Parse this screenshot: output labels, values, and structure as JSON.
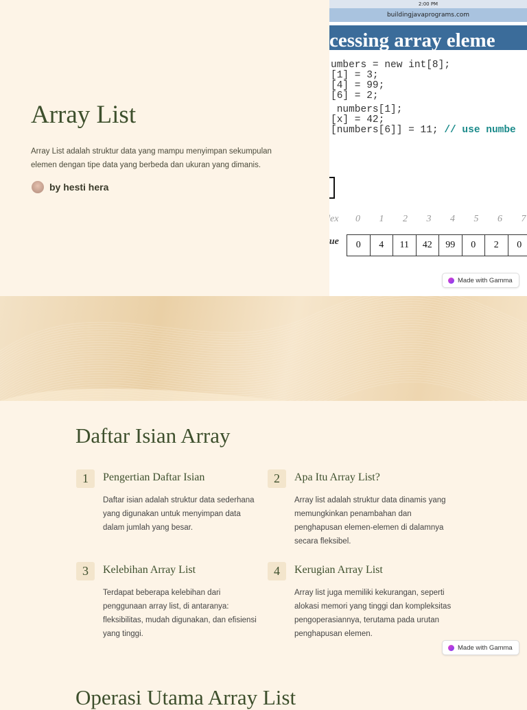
{
  "hero": {
    "title": "Array List",
    "description": "Array List adalah struktur data yang mampu menyimpan sekumpulan elemen dengan tipe data yang berbeda dan ukuran yang dimanis.",
    "author": "by hesti hera"
  },
  "screenshot": {
    "status_time": "2:00 PM",
    "url": "buildingjavaprograms.com",
    "slide_title": "cessing array eleme",
    "code_lines": [
      "umbers = new int[8];",
      "[1] = 3;",
      "[4] = 99;",
      "[6] = 2;",
      " numbers[1];",
      "[x] = 42;",
      "[numbers[6]] = 11; "
    ],
    "code_comment": "// use numbe",
    "index_label": "dex",
    "value_label": "lue",
    "indices": [
      "0",
      "1",
      "2",
      "3",
      "4",
      "5",
      "6",
      "7"
    ],
    "values": [
      "0",
      "4",
      "11",
      "42",
      "99",
      "0",
      "2",
      "0"
    ]
  },
  "badge_label": "Made with Gamma",
  "section": {
    "title": "Daftar Isian Array",
    "items": [
      {
        "num": "1",
        "title": "Pengertian Daftar Isian",
        "body": "Daftar isian adalah struktur data sederhana yang digunakan untuk menyimpan data dalam jumlah yang besar."
      },
      {
        "num": "2",
        "title": "Apa Itu Array List?",
        "body": "Array list adalah struktur data dinamis yang memungkinkan penambahan dan penghapusan elemen-elemen di dalamnya secara fleksibel."
      },
      {
        "num": "3",
        "title": "Kelebihan Array List",
        "body": "Terdapat beberapa kelebihan dari penggunaan array list, di antaranya: fleksibilitas, mudah digunakan, dan efisiensi yang tinggi."
      },
      {
        "num": "4",
        "title": "Kerugian Array List",
        "body": "Array list juga memiliki kekurangan, seperti alokasi memori yang tinggi dan kompleksitas pengoperasiannya, terutama pada urutan penghapusan elemen."
      }
    ]
  },
  "next_section_title": "Operasi Utama Array List"
}
